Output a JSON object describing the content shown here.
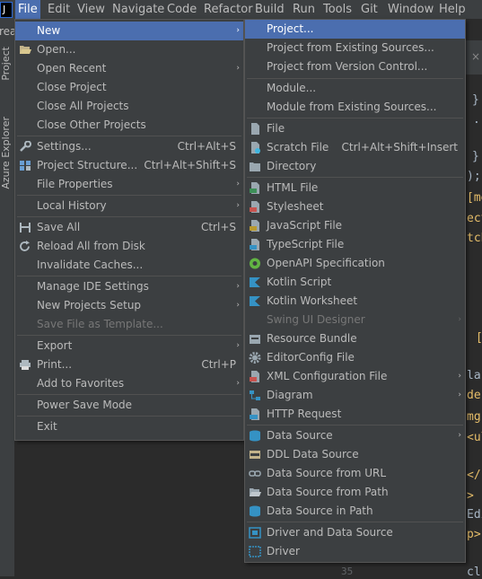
{
  "app": {
    "icon_letter": "J"
  },
  "menubar": [
    "File",
    "Edit",
    "View",
    "Navigate",
    "Code",
    "Refactor",
    "Build",
    "Run",
    "Tools",
    "Git",
    "Window",
    "Help"
  ],
  "background": {
    "left_tab": "rea",
    "vertical_tab_1": "Project",
    "vertical_tab_2": "Azure Explorer",
    "code_lines": [
      "}",
      ".",
      "}",
      ");",
      "[me",
      "ect",
      "tch",
      "[",
      "las",
      "der",
      "mg",
      "<ul",
      "</",
      ">",
      "Edi",
      "p>",
      "cl"
    ],
    "gutter_number": "35"
  },
  "file_menu": {
    "items": [
      {
        "label": "New",
        "arrow": "›",
        "selected": true
      },
      {
        "label": "Open..."
      },
      {
        "label": "Open Recent",
        "arrow": "›"
      },
      {
        "label": "Close Project"
      },
      {
        "label": "Close All Projects"
      },
      {
        "label": "Close Other Projects"
      },
      {
        "label": "Settings...",
        "shortcut": "Ctrl+Alt+S"
      },
      {
        "label": "Project Structure...",
        "shortcut": "Ctrl+Alt+Shift+S"
      },
      {
        "label": "File Properties",
        "arrow": "›"
      },
      {
        "label": "Local History",
        "arrow": "›"
      },
      {
        "label": "Save All",
        "shortcut": "Ctrl+S"
      },
      {
        "label": "Reload All from Disk"
      },
      {
        "label": "Invalidate Caches..."
      },
      {
        "label": "Manage IDE Settings",
        "arrow": "›"
      },
      {
        "label": "New Projects Setup",
        "arrow": "›"
      },
      {
        "label": "Save File as Template...",
        "disabled": true
      },
      {
        "label": "Export",
        "arrow": "›"
      },
      {
        "label": "Print...",
        "shortcut": "Ctrl+P"
      },
      {
        "label": "Add to Favorites",
        "arrow": "›"
      },
      {
        "label": "Power Save Mode"
      },
      {
        "label": "Exit"
      }
    ]
  },
  "new_submenu": {
    "items": [
      {
        "label": "Project...",
        "selected": true
      },
      {
        "label": "Project from Existing Sources..."
      },
      {
        "label": "Project from Version Control..."
      },
      {
        "label": "Module..."
      },
      {
        "label": "Module from Existing Sources..."
      },
      {
        "label": "File"
      },
      {
        "label": "Scratch File",
        "shortcut": "Ctrl+Alt+Shift+Insert"
      },
      {
        "label": "Directory"
      },
      {
        "label": "HTML File"
      },
      {
        "label": "Stylesheet"
      },
      {
        "label": "JavaScript File"
      },
      {
        "label": "TypeScript File"
      },
      {
        "label": "OpenAPI Specification"
      },
      {
        "label": "Kotlin Script"
      },
      {
        "label": "Kotlin Worksheet"
      },
      {
        "label": "Swing UI Designer",
        "arrow": "›",
        "disabled": true
      },
      {
        "label": "Resource Bundle"
      },
      {
        "label": "EditorConfig File"
      },
      {
        "label": "XML Configuration File",
        "arrow": "›"
      },
      {
        "label": "Diagram",
        "arrow": "›"
      },
      {
        "label": "HTTP Request"
      },
      {
        "label": "Data Source",
        "arrow": "›"
      },
      {
        "label": "DDL Data Source"
      },
      {
        "label": "Data Source from URL"
      },
      {
        "label": "Data Source from Path"
      },
      {
        "label": "Data Source in Path"
      },
      {
        "label": "Driver and Data Source"
      },
      {
        "label": "Driver"
      }
    ]
  }
}
